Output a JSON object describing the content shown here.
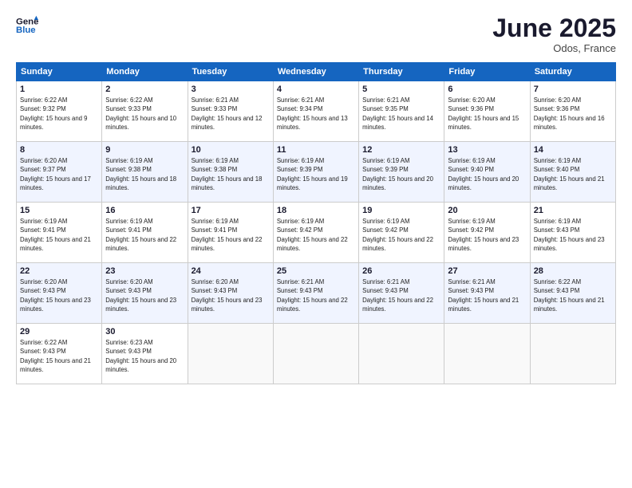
{
  "header": {
    "logo_line1": "General",
    "logo_line2": "Blue",
    "month": "June 2025",
    "location": "Odos, France"
  },
  "weekdays": [
    "Sunday",
    "Monday",
    "Tuesday",
    "Wednesday",
    "Thursday",
    "Friday",
    "Saturday"
  ],
  "weeks": [
    [
      {
        "day": "1",
        "sunrise": "6:22 AM",
        "sunset": "9:32 PM",
        "daylight": "15 hours and 9 minutes."
      },
      {
        "day": "2",
        "sunrise": "6:22 AM",
        "sunset": "9:33 PM",
        "daylight": "15 hours and 10 minutes."
      },
      {
        "day": "3",
        "sunrise": "6:21 AM",
        "sunset": "9:33 PM",
        "daylight": "15 hours and 12 minutes."
      },
      {
        "day": "4",
        "sunrise": "6:21 AM",
        "sunset": "9:34 PM",
        "daylight": "15 hours and 13 minutes."
      },
      {
        "day": "5",
        "sunrise": "6:21 AM",
        "sunset": "9:35 PM",
        "daylight": "15 hours and 14 minutes."
      },
      {
        "day": "6",
        "sunrise": "6:20 AM",
        "sunset": "9:36 PM",
        "daylight": "15 hours and 15 minutes."
      },
      {
        "day": "7",
        "sunrise": "6:20 AM",
        "sunset": "9:36 PM",
        "daylight": "15 hours and 16 minutes."
      }
    ],
    [
      {
        "day": "8",
        "sunrise": "6:20 AM",
        "sunset": "9:37 PM",
        "daylight": "15 hours and 17 minutes."
      },
      {
        "day": "9",
        "sunrise": "6:19 AM",
        "sunset": "9:38 PM",
        "daylight": "15 hours and 18 minutes."
      },
      {
        "day": "10",
        "sunrise": "6:19 AM",
        "sunset": "9:38 PM",
        "daylight": "15 hours and 18 minutes."
      },
      {
        "day": "11",
        "sunrise": "6:19 AM",
        "sunset": "9:39 PM",
        "daylight": "15 hours and 19 minutes."
      },
      {
        "day": "12",
        "sunrise": "6:19 AM",
        "sunset": "9:39 PM",
        "daylight": "15 hours and 20 minutes."
      },
      {
        "day": "13",
        "sunrise": "6:19 AM",
        "sunset": "9:40 PM",
        "daylight": "15 hours and 20 minutes."
      },
      {
        "day": "14",
        "sunrise": "6:19 AM",
        "sunset": "9:40 PM",
        "daylight": "15 hours and 21 minutes."
      }
    ],
    [
      {
        "day": "15",
        "sunrise": "6:19 AM",
        "sunset": "9:41 PM",
        "daylight": "15 hours and 21 minutes."
      },
      {
        "day": "16",
        "sunrise": "6:19 AM",
        "sunset": "9:41 PM",
        "daylight": "15 hours and 22 minutes."
      },
      {
        "day": "17",
        "sunrise": "6:19 AM",
        "sunset": "9:41 PM",
        "daylight": "15 hours and 22 minutes."
      },
      {
        "day": "18",
        "sunrise": "6:19 AM",
        "sunset": "9:42 PM",
        "daylight": "15 hours and 22 minutes."
      },
      {
        "day": "19",
        "sunrise": "6:19 AM",
        "sunset": "9:42 PM",
        "daylight": "15 hours and 22 minutes."
      },
      {
        "day": "20",
        "sunrise": "6:19 AM",
        "sunset": "9:42 PM",
        "daylight": "15 hours and 23 minutes."
      },
      {
        "day": "21",
        "sunrise": "6:19 AM",
        "sunset": "9:43 PM",
        "daylight": "15 hours and 23 minutes."
      }
    ],
    [
      {
        "day": "22",
        "sunrise": "6:20 AM",
        "sunset": "9:43 PM",
        "daylight": "15 hours and 23 minutes."
      },
      {
        "day": "23",
        "sunrise": "6:20 AM",
        "sunset": "9:43 PM",
        "daylight": "15 hours and 23 minutes."
      },
      {
        "day": "24",
        "sunrise": "6:20 AM",
        "sunset": "9:43 PM",
        "daylight": "15 hours and 23 minutes."
      },
      {
        "day": "25",
        "sunrise": "6:21 AM",
        "sunset": "9:43 PM",
        "daylight": "15 hours and 22 minutes."
      },
      {
        "day": "26",
        "sunrise": "6:21 AM",
        "sunset": "9:43 PM",
        "daylight": "15 hours and 22 minutes."
      },
      {
        "day": "27",
        "sunrise": "6:21 AM",
        "sunset": "9:43 PM",
        "daylight": "15 hours and 21 minutes."
      },
      {
        "day": "28",
        "sunrise": "6:22 AM",
        "sunset": "9:43 PM",
        "daylight": "15 hours and 21 minutes."
      }
    ],
    [
      {
        "day": "29",
        "sunrise": "6:22 AM",
        "sunset": "9:43 PM",
        "daylight": "15 hours and 21 minutes."
      },
      {
        "day": "30",
        "sunrise": "6:23 AM",
        "sunset": "9:43 PM",
        "daylight": "15 hours and 20 minutes."
      },
      null,
      null,
      null,
      null,
      null
    ]
  ]
}
